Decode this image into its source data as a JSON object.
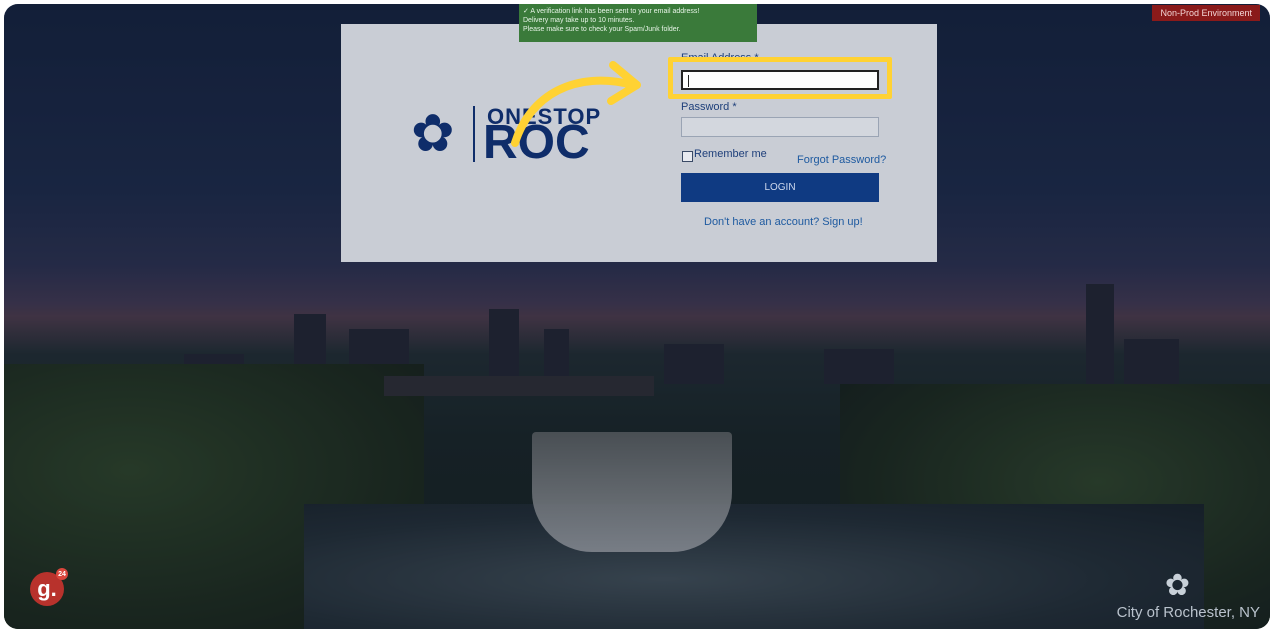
{
  "environment_badge": "Non-Prod Environment",
  "toast": {
    "line1": "✓ A verification link has been sent to your email address!",
    "line2": "Delivery may take up to 10 minutes.",
    "line3": "Please make sure to check your Spam/Junk folder."
  },
  "logo": {
    "top": "ONESTOP",
    "bottom": "ROC"
  },
  "form": {
    "email_label": "Email Address *",
    "email_value": "",
    "password_label": "Password *",
    "password_value": "",
    "remember_label": "Remember me",
    "forgot_label": "Forgot Password?",
    "login_label": "LOGIN",
    "signup_label": "Don't have an account? Sign up!"
  },
  "footer": {
    "city": "City of Rochester, NY",
    "app_badge": "g.",
    "app_badge_sup": "24"
  },
  "colors": {
    "highlight": "#ffd233",
    "primary": "#0f3a82",
    "toast": "#3a7a3a",
    "badge": "#8a1a1a"
  }
}
